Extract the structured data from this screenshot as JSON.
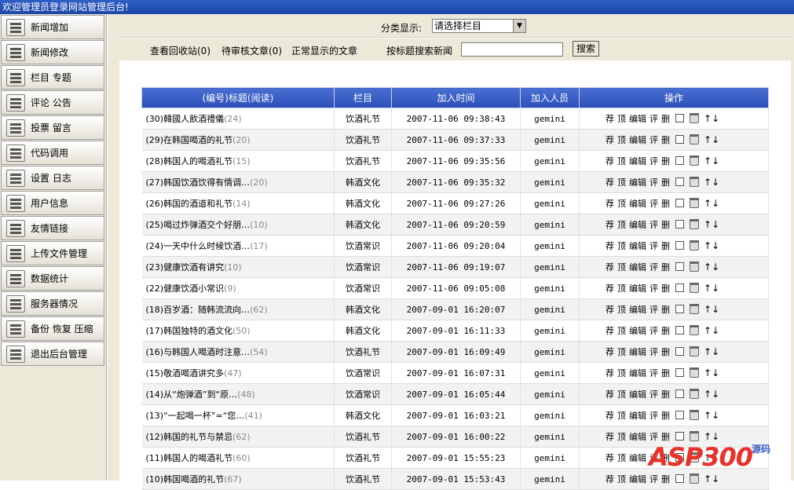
{
  "header": {
    "title": "欢迎管理员登录网站管理后台!"
  },
  "sidebar": {
    "items": [
      {
        "label": "新闻增加",
        "icon": "news-add-icon"
      },
      {
        "label": "新闻修改",
        "icon": "news-edit-icon"
      },
      {
        "label": "栏目 专题",
        "icon": "column-icon"
      },
      {
        "label": "评论 公告",
        "icon": "comment-icon"
      },
      {
        "label": "投票 留言",
        "icon": "vote-icon"
      },
      {
        "label": "代码调用",
        "icon": "code-icon"
      },
      {
        "label": "设置 日志",
        "icon": "settings-icon"
      },
      {
        "label": "用户信息",
        "icon": "user-icon"
      },
      {
        "label": "友情链接",
        "icon": "link-icon"
      },
      {
        "label": "上传文件管理",
        "icon": "upload-icon"
      },
      {
        "label": "数据统计",
        "icon": "stats-icon"
      },
      {
        "label": "服务器情况",
        "icon": "server-icon"
      },
      {
        "label": "备份 恢复 压缩",
        "icon": "backup-icon"
      },
      {
        "label": "退出后台管理",
        "icon": "exit-icon"
      }
    ]
  },
  "filter": {
    "label": "分类显示:",
    "selected": "请选择栏目"
  },
  "actions": {
    "recycle": "查看回收站(0)",
    "pending": "待审核文章(0)",
    "normal": "正常显示的文章",
    "search_label": "按标题搜索新闻",
    "search_value": "",
    "search_button": "搜索"
  },
  "table": {
    "headers": [
      "(编号)标题(阅读)",
      "栏目",
      "加入时间",
      "加入人员",
      "操作"
    ],
    "op_labels": {
      "recommend": "荐",
      "top": "顶",
      "edit": "编辑",
      "comment": "评",
      "delete": "删",
      "up": "↑",
      "down": "↓"
    },
    "rows": [
      {
        "title": "(30)韓國人飲酒禮儀",
        "reads": "(24)",
        "category": "饮酒礼节",
        "time": "2007-11-06 09:38:43",
        "user": "gemini"
      },
      {
        "title": "(29)在韩国喝酒的礼节",
        "reads": "(20)",
        "category": "饮酒礼节",
        "time": "2007-11-06 09:37:33",
        "user": "gemini"
      },
      {
        "title": "(28)韩国人的喝酒礼节",
        "reads": "(15)",
        "category": "饮酒礼节",
        "time": "2007-11-06 09:35:56",
        "user": "gemini"
      },
      {
        "title": "(27)韩国饮酒饮得有情调…",
        "reads": "(20)",
        "category": "韩酒文化",
        "time": "2007-11-06 09:35:32",
        "user": "gemini"
      },
      {
        "title": "(26)韩国的酒道和礼节",
        "reads": "(14)",
        "category": "韩酒文化",
        "time": "2007-11-06 09:27:26",
        "user": "gemini"
      },
      {
        "title": "(25)喝过炸弹酒交个好朋…",
        "reads": "(10)",
        "category": "韩酒文化",
        "time": "2007-11-06 09:20:59",
        "user": "gemini"
      },
      {
        "title": "(24)一天中什么时候饮酒…",
        "reads": "(17)",
        "category": "饮酒常识",
        "time": "2007-11-06 09:20:04",
        "user": "gemini"
      },
      {
        "title": "(23)健康饮酒有讲究",
        "reads": "(10)",
        "category": "饮酒常识",
        "time": "2007-11-06 09:19:07",
        "user": "gemini"
      },
      {
        "title": "(22)健康饮酒小常识",
        "reads": "(9)",
        "category": "饮酒常识",
        "time": "2007-11-06 09:05:08",
        "user": "gemini"
      },
      {
        "title": "(18)百岁酒：随韩流流向…",
        "reads": "(62)",
        "category": "韩酒文化",
        "time": "2007-09-01 16:20:07",
        "user": "gemini"
      },
      {
        "title": "(17)韩国独特的酒文化",
        "reads": "(50)",
        "category": "韩酒文化",
        "time": "2007-09-01 16:11:33",
        "user": "gemini"
      },
      {
        "title": "(16)与韩国人喝酒时注意…",
        "reads": "(54)",
        "category": "饮酒礼节",
        "time": "2007-09-01 16:09:49",
        "user": "gemini"
      },
      {
        "title": "(15)敬酒喝酒讲究多",
        "reads": "(47)",
        "category": "饮酒常识",
        "time": "2007-09-01 16:07:31",
        "user": "gemini"
      },
      {
        "title": "(14)从“炮弹酒”到“原…",
        "reads": "(48)",
        "category": "饮酒常识",
        "time": "2007-09-01 16:05:44",
        "user": "gemini"
      },
      {
        "title": "(13)“一起喝一杯”=“您…",
        "reads": "(41)",
        "category": "韩酒文化",
        "time": "2007-09-01 16:03:21",
        "user": "gemini"
      },
      {
        "title": "(12)韩国的礼节与禁忌",
        "reads": "(62)",
        "category": "饮酒礼节",
        "time": "2007-09-01 16:00:22",
        "user": "gemini"
      },
      {
        "title": "(11)韩国人的喝酒礼节",
        "reads": "(60)",
        "category": "饮酒礼节",
        "time": "2007-09-01 15:55:23",
        "user": "gemini"
      },
      {
        "title": "(10)韩国喝酒的礼节",
        "reads": "(67)",
        "category": "饮酒礼节",
        "time": "2007-09-01 15:53:43",
        "user": "gemini"
      }
    ]
  },
  "watermark": {
    "text": "ASP300",
    "sub": "源码"
  }
}
